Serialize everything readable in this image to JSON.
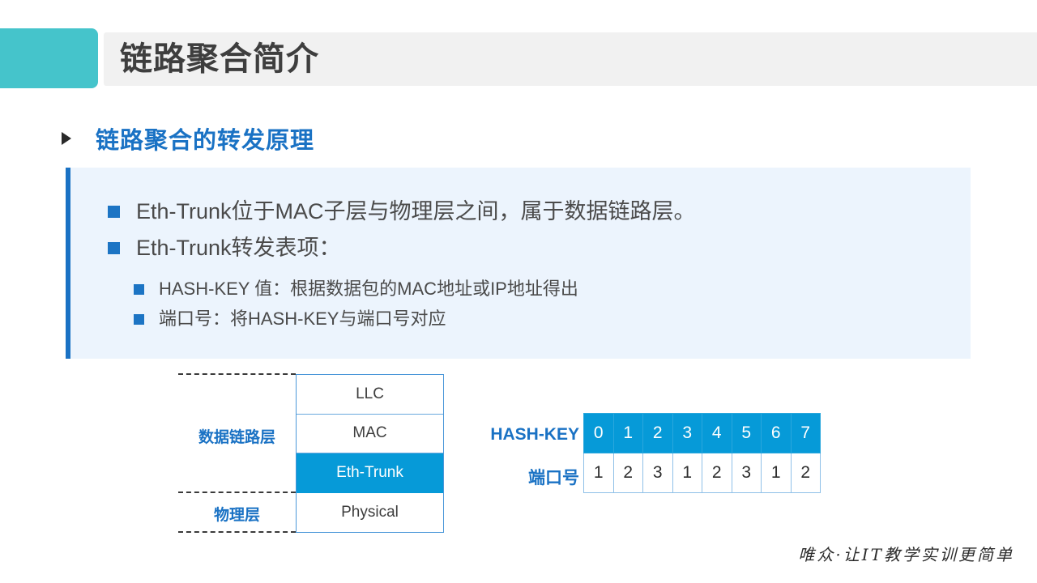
{
  "header": {
    "title": "链路聚合简介",
    "accent_color": "#45c4cb",
    "bar_color": "#f1f1f1"
  },
  "section": {
    "heading": "链路聚合的转发原理",
    "heading_color": "#1a72c4"
  },
  "panel": {
    "background": "#ecf4fd",
    "accent_color": "#1a72c4",
    "bullets": [
      {
        "level": 1,
        "text": "Eth-Trunk位于MAC子层与物理层之间，属于数据链路层。"
      },
      {
        "level": 1,
        "text": "Eth-Trunk转发表项："
      },
      {
        "level": 2,
        "text": "HASH-KEY 值：根据数据包的MAC地址或IP地址得出"
      },
      {
        "level": 2,
        "text": "端口号：将HASH-KEY与端口号对应"
      }
    ]
  },
  "stack_diagram": {
    "layers": [
      {
        "name": "LLC",
        "highlighted": false
      },
      {
        "name": "MAC",
        "highlighted": false
      },
      {
        "name": "Eth-Trunk",
        "highlighted": true
      },
      {
        "name": "Physical",
        "highlighted": false
      }
    ],
    "side_labels": [
      {
        "text": "数据链路层"
      },
      {
        "text": "物理层"
      }
    ],
    "highlight_color": "#069ad8",
    "border_color": "#4a97d9"
  },
  "hash_table": {
    "row_labels": {
      "key": "HASH-KEY",
      "port": "端口号"
    },
    "hash_keys": [
      "0",
      "1",
      "2",
      "3",
      "4",
      "5",
      "6",
      "7"
    ],
    "ports": [
      "1",
      "2",
      "3",
      "1",
      "2",
      "3",
      "1",
      "2"
    ],
    "header_color": "#069ad8",
    "label_color": "#1a72c4"
  },
  "footer": {
    "brand": "唯众·让IT教学实训更简单"
  }
}
